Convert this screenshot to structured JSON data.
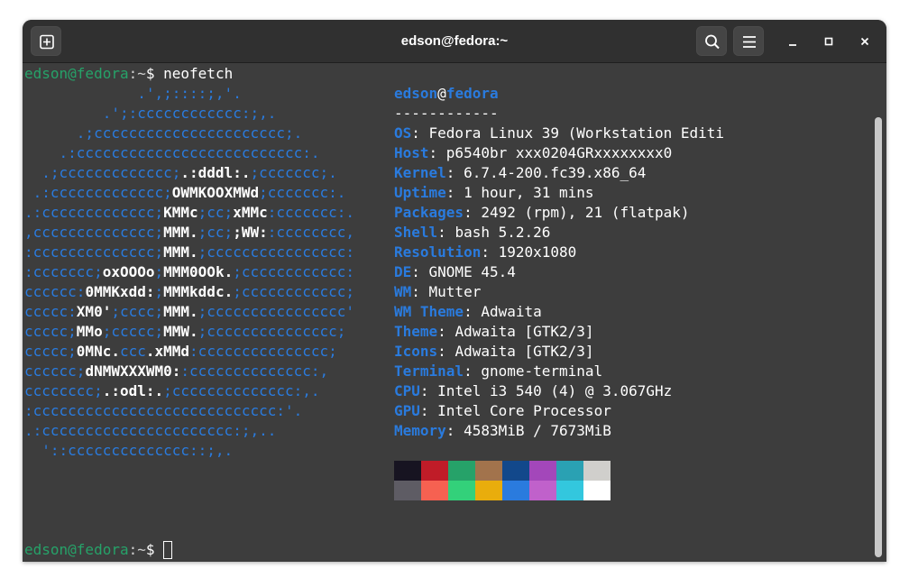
{
  "window": {
    "title": "edson@fedora:~"
  },
  "prompt": {
    "user_host": "edson@fedora",
    "sep": ":",
    "path": "~",
    "symbol": "$ ",
    "command": "neofetch"
  },
  "logo": [
    [
      [
        "a",
        "             .',;::::;,'."
      ]
    ],
    [
      [
        "a",
        "         .';:cccccccccccc:;,."
      ]
    ],
    [
      [
        "a",
        "      .;cccccccccccccccccccccc;."
      ]
    ],
    [
      [
        "a",
        "    .:cccccccccccccccccccccccccc:."
      ]
    ],
    [
      [
        "a",
        "  .;ccccccccccccc;"
      ],
      [
        "b",
        ".:dddl:."
      ],
      [
        "a",
        ";ccccccc;."
      ]
    ],
    [
      [
        "a",
        " .:ccccccccccccc;"
      ],
      [
        "b",
        "OWMKOOXMWd"
      ],
      [
        "a",
        ";ccccccc:."
      ]
    ],
    [
      [
        "a",
        ".:ccccccccccccc;"
      ],
      [
        "b",
        "KMMc"
      ],
      [
        "a",
        ";cc;"
      ],
      [
        "b",
        "xMMc"
      ],
      [
        "a",
        ":ccccccc:."
      ]
    ],
    [
      [
        "a",
        ",cccccccccccccc;"
      ],
      [
        "b",
        "MMM."
      ],
      [
        "a",
        ";cc;"
      ],
      [
        "b",
        ";WW:"
      ],
      [
        "a",
        ":cccccccc,"
      ]
    ],
    [
      [
        "a",
        ":cccccccccccccc;"
      ],
      [
        "b",
        "MMM."
      ],
      [
        "a",
        ";cccccccccccccccc:"
      ]
    ],
    [
      [
        "a",
        ":ccccccc;"
      ],
      [
        "b",
        "oxOOOo"
      ],
      [
        "a",
        ";"
      ],
      [
        "b",
        "MMM0OOk."
      ],
      [
        "a",
        ";cccccccccccc:"
      ]
    ],
    [
      [
        "a",
        "cccccc:"
      ],
      [
        "b",
        "0MMKxdd:"
      ],
      [
        "a",
        ";"
      ],
      [
        "b",
        "MMMkddc."
      ],
      [
        "a",
        ";cccccccccccc;"
      ]
    ],
    [
      [
        "a",
        "ccccc:"
      ],
      [
        "b",
        "XM0'"
      ],
      [
        "a",
        ";cccc;"
      ],
      [
        "b",
        "MMM."
      ],
      [
        "a",
        ";cccccccccccccccc'"
      ]
    ],
    [
      [
        "a",
        "ccccc;"
      ],
      [
        "b",
        "MMo"
      ],
      [
        "a",
        ";ccccc;"
      ],
      [
        "b",
        "MMW."
      ],
      [
        "a",
        ";ccccccccccccccc;"
      ]
    ],
    [
      [
        "a",
        "ccccc;"
      ],
      [
        "b",
        "0MNc."
      ],
      [
        "a",
        "ccc"
      ],
      [
        "b",
        ".xMMd"
      ],
      [
        "a",
        ":ccccccccccccccc;"
      ]
    ],
    [
      [
        "a",
        "cccccc;"
      ],
      [
        "b",
        "dNMWXXXWM0:"
      ],
      [
        "a",
        ":cccccccccccccc:,"
      ]
    ],
    [
      [
        "a",
        "cccccccc;"
      ],
      [
        "b",
        ".:odl:."
      ],
      [
        "a",
        ";cccccccccccccc:,."
      ]
    ],
    [
      [
        "a",
        ":cccccccccccccccccccccccccccc:'."
      ]
    ],
    [
      [
        "a",
        ".:cccccccccccccccccccccc:;,.."
      ]
    ],
    [
      [
        "a",
        "  '::cccccccccccccc::;,."
      ]
    ]
  ],
  "info": {
    "user": "edson",
    "at": "@",
    "host": "fedora",
    "separator": "------------",
    "rows": [
      {
        "key": "OS",
        "value": "Fedora Linux 39 (Workstation Editi"
      },
      {
        "key": "Host",
        "value": "p6540br xxx0204GRxxxxxxxx0"
      },
      {
        "key": "Kernel",
        "value": "6.7.4-200.fc39.x86_64"
      },
      {
        "key": "Uptime",
        "value": "1 hour, 31 mins"
      },
      {
        "key": "Packages",
        "value": "2492 (rpm), 21 (flatpak)"
      },
      {
        "key": "Shell",
        "value": "bash 5.2.26"
      },
      {
        "key": "Resolution",
        "value": "1920x1080"
      },
      {
        "key": "DE",
        "value": "GNOME 45.4"
      },
      {
        "key": "WM",
        "value": "Mutter"
      },
      {
        "key": "WM Theme",
        "value": "Adwaita"
      },
      {
        "key": "Theme",
        "value": "Adwaita [GTK2/3]"
      },
      {
        "key": "Icons",
        "value": "Adwaita [GTK2/3]"
      },
      {
        "key": "Terminal",
        "value": "gnome-terminal"
      },
      {
        "key": "CPU",
        "value": "Intel i3 540 (4) @ 3.067GHz"
      },
      {
        "key": "GPU",
        "value": "Intel Core Processor"
      },
      {
        "key": "Memory",
        "value": "4583MiB / 7673MiB"
      }
    ]
  },
  "palette": {
    "normal": [
      "#171421",
      "#c01c28",
      "#26a269",
      "#a2734c",
      "#12488b",
      "#a347ba",
      "#2aa1b3",
      "#d0cfcc"
    ],
    "bright": [
      "#5e5c64",
      "#f66151",
      "#33d17a",
      "#e9ad0c",
      "#2a7bde",
      "#c061cb",
      "#33c7de",
      "#ffffff"
    ]
  },
  "icons": {
    "new_tab": "new-tab-icon",
    "search": "search-icon",
    "menu": "hamburger-menu-icon",
    "minimize": "minimize-icon",
    "maximize": "maximize-icon",
    "close": "close-icon"
  }
}
